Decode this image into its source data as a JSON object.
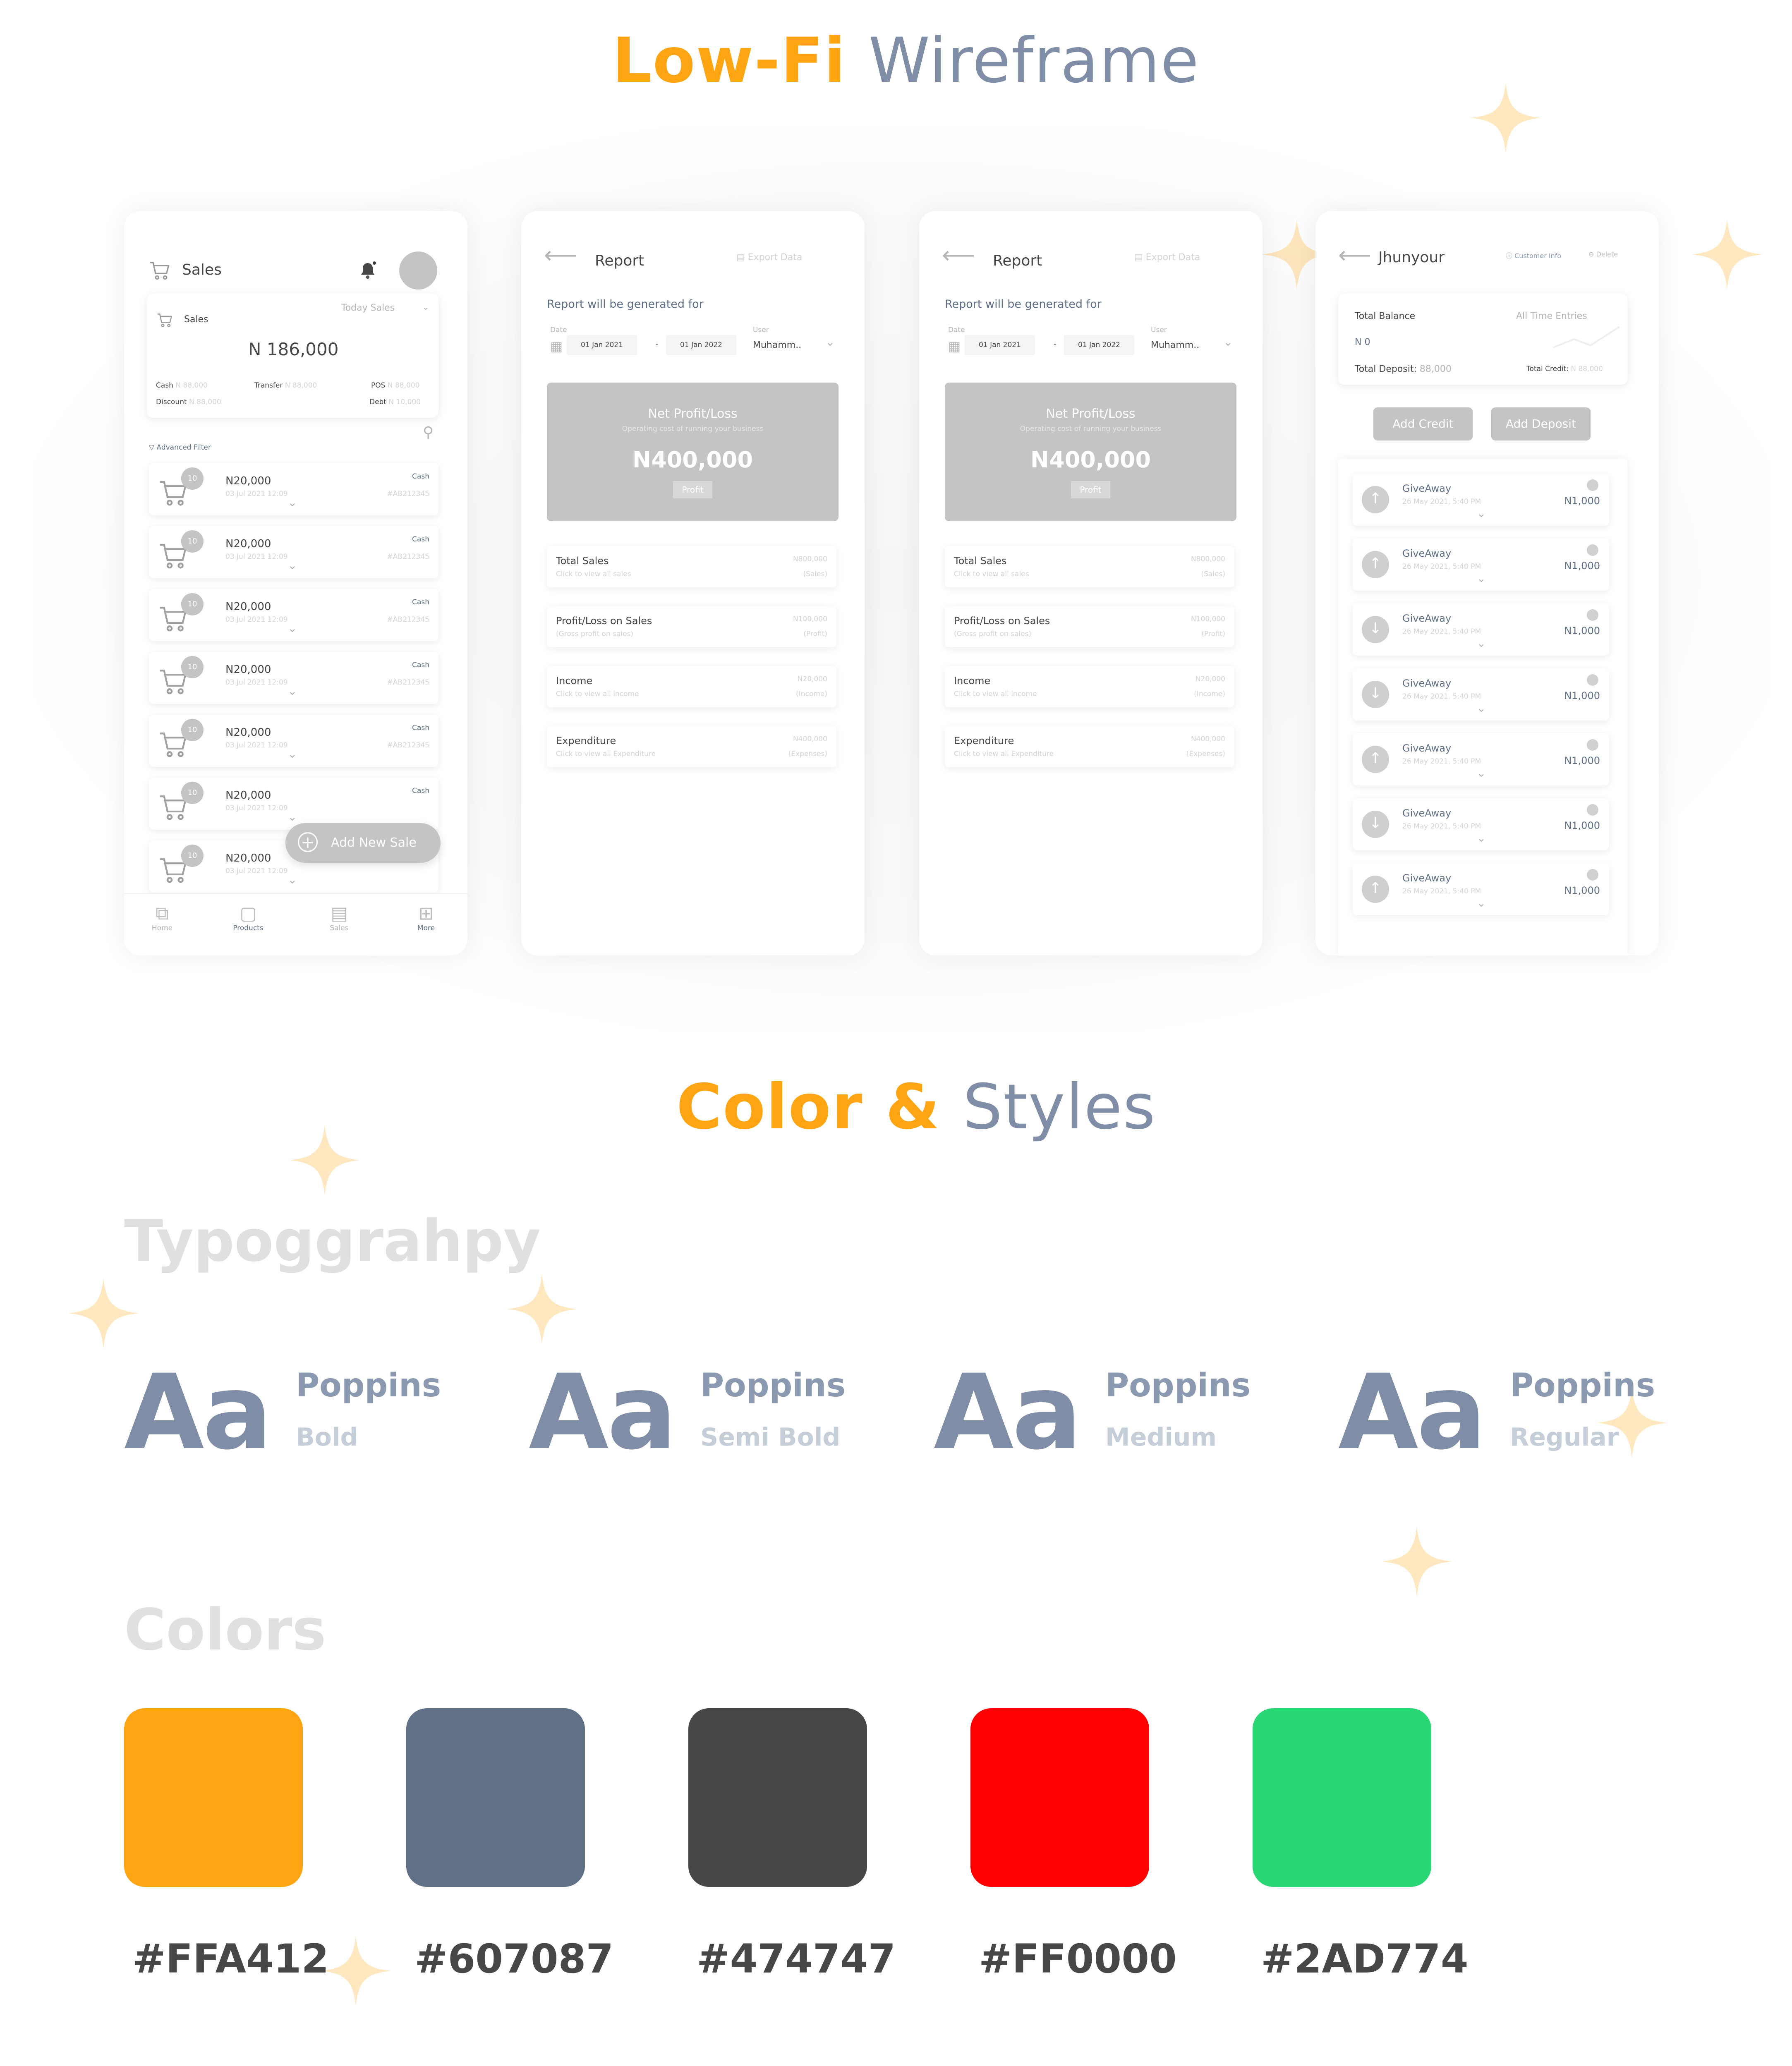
{
  "headings": {
    "wireframe_a": "Low-Fi",
    "wireframe_b": "Wireframe",
    "styles_a": "Color &",
    "styles_b": "Styles",
    "typography": "Typoggrahpy",
    "colors": "Colors"
  },
  "sales_screen": {
    "title": "Sales",
    "summary_label": "Sales",
    "filter": "Today Sales",
    "total": "N 186,000",
    "cash": "Cash",
    "cash_val": "N 88,000",
    "transfer": "Transfer",
    "transfer_val": "N 88,000",
    "pos": "POS",
    "pos_val": "N 88,000",
    "discount": "Discount",
    "discount_val": "N 88,000",
    "debt": "Debt",
    "debt_val": "N 10,000",
    "advanced_filter": "Advanced Filter",
    "rows": [
      {
        "qty": "10",
        "amount": "N20,000",
        "date": "03 Jul 2021 12:09",
        "method": "Cash",
        "ref": "#AB212345"
      },
      {
        "qty": "10",
        "amount": "N20,000",
        "date": "03 Jul 2021 12:09",
        "method": "Cash",
        "ref": "#AB212345"
      },
      {
        "qty": "10",
        "amount": "N20,000",
        "date": "03 Jul 2021 12:09",
        "method": "Cash",
        "ref": "#AB212345"
      },
      {
        "qty": "10",
        "amount": "N20,000",
        "date": "03 Jul 2021 12:09",
        "method": "Cash",
        "ref": "#AB212345"
      },
      {
        "qty": "10",
        "amount": "N20,000",
        "date": "03 Jul 2021 12:09",
        "method": "Cash",
        "ref": "#AB212345"
      },
      {
        "qty": "10",
        "amount": "N20,000",
        "date": "03 Jul 2021 12:09",
        "method": "Cash",
        "ref": ""
      },
      {
        "qty": "10",
        "amount": "N20,000",
        "date": "03 Jul 2021 12:09",
        "method": "",
        "ref": ""
      }
    ],
    "add_new_sale": "Add New Sale",
    "nav": {
      "home": "Home",
      "products": "Products",
      "sales": "Sales",
      "more": "More"
    }
  },
  "report_screen": {
    "title": "Report",
    "export": "Export Data",
    "subtitle": "Report will be generated for",
    "date_label": "Date",
    "user_label": "User",
    "date_from": "01 Jan 2021",
    "date_sep": "-",
    "date_to": "01 Jan 2022",
    "user": "Muhamm..",
    "net_title": "Net Profit/Loss",
    "net_sub": "Operating cost of running your business",
    "net_value": "N400,000",
    "net_tag": "Profit",
    "rows": [
      {
        "title": "Total Sales",
        "sub": "Click to view all sales",
        "value": "N800,000",
        "tag": "(Sales)"
      },
      {
        "title": "Profit/Loss on Sales",
        "sub": "(Gross profit on sales)",
        "value": "N100,000",
        "tag": "(Profit)"
      },
      {
        "title": "Income",
        "sub": "Click to view all income",
        "value": "N20,000",
        "tag": "(Income)"
      },
      {
        "title": "Expenditure",
        "sub": "Click to view all Expenditure",
        "value": "N400,000",
        "tag": "(Expenses)"
      }
    ]
  },
  "customer_screen": {
    "title": "Jhunyour",
    "customer_info": "Customer Info",
    "delete": "Delete",
    "balance_label": "Total Balance",
    "filter": "All Time Entries",
    "balance": "N 0",
    "deposit_label": "Total Deposit:",
    "deposit_val": "88,000",
    "credit_label": "Total Credit:",
    "credit_val": "N 88,000",
    "add_credit": "Add Credit",
    "add_deposit": "Add Deposit",
    "transactions": [
      {
        "title": "GiveAway",
        "date": "26 May 2021, 5:40 PM",
        "amount": "N1,000",
        "dir": "up"
      },
      {
        "title": "GiveAway",
        "date": "26 May 2021, 5:40 PM",
        "amount": "N1,000",
        "dir": "up"
      },
      {
        "title": "GiveAway",
        "date": "26 May 2021, 5:40 PM",
        "amount": "N1,000",
        "dir": "down"
      },
      {
        "title": "GiveAway",
        "date": "26 May 2021, 5:40 PM",
        "amount": "N1,000",
        "dir": "down"
      },
      {
        "title": "GiveAway",
        "date": "26 May 2021, 5:40 PM",
        "amount": "N1,000",
        "dir": "up"
      },
      {
        "title": "GiveAway",
        "date": "26 May 2021, 5:40 PM",
        "amount": "N1,000",
        "dir": "down"
      },
      {
        "title": "GiveAway",
        "date": "26 May 2021, 5:40 PM",
        "amount": "N1,000",
        "dir": "up"
      }
    ]
  },
  "typography": [
    {
      "sample": "Aa",
      "family": "Poppins",
      "weight": "Bold"
    },
    {
      "sample": "Aa",
      "family": "Poppins",
      "weight": "Semi Bold"
    },
    {
      "sample": "Aa",
      "family": "Poppins",
      "weight": "Medium"
    },
    {
      "sample": "Aa",
      "family": "Poppins",
      "weight": "Regular"
    }
  ],
  "colors": [
    {
      "hex": "#FFA412"
    },
    {
      "hex": "#607087"
    },
    {
      "hex": "#474747"
    },
    {
      "hex": "#FF0000"
    },
    {
      "hex": "#2AD774"
    }
  ],
  "star_icon": "sparkle-star",
  "accent_colors": {
    "orange": "#FFA412",
    "slate": "#7f8ea6",
    "star": "#FFE8BF"
  }
}
